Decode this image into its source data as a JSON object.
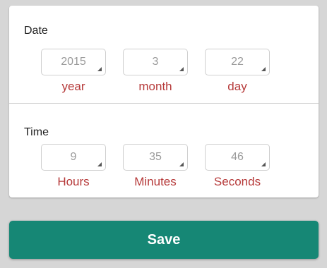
{
  "date_section": {
    "title": "Date",
    "fields": [
      {
        "value": "2015",
        "label": "year"
      },
      {
        "value": "3",
        "label": "month"
      },
      {
        "value": "22",
        "label": "day"
      }
    ]
  },
  "time_section": {
    "title": "Time",
    "fields": [
      {
        "value": "9",
        "label": "Hours"
      },
      {
        "value": "35",
        "label": "Minutes"
      },
      {
        "value": "46",
        "label": "Seconds"
      }
    ]
  },
  "actions": {
    "save_label": "Save"
  },
  "colors": {
    "accent": "#168775",
    "field_label": "#b63a3a",
    "background": "#d6d6d6"
  },
  "icons": {
    "spinner_corner": "dropdown-corner-icon"
  }
}
